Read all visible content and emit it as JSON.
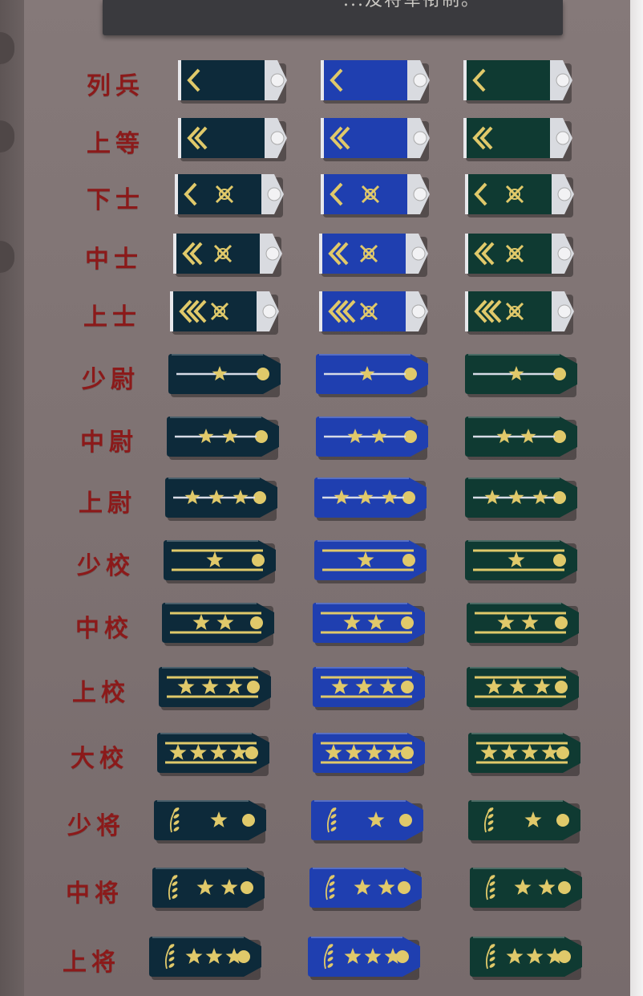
{
  "header": {
    "text": "...及将军衔制。"
  },
  "ranks": [
    {
      "label": "列兵",
      "type": "enlisted",
      "chevrons": 1,
      "emblem": false
    },
    {
      "label": "上等",
      "type": "enlisted",
      "chevrons": 2,
      "emblem": false
    },
    {
      "label": "下士",
      "type": "enlisted",
      "chevrons": 1,
      "emblem": true
    },
    {
      "label": "中士",
      "type": "enlisted",
      "chevrons": 2,
      "emblem": true
    },
    {
      "label": "上士",
      "type": "enlisted",
      "chevrons": 3,
      "emblem": true
    },
    {
      "label": "少尉",
      "type": "junior",
      "stars": 1
    },
    {
      "label": "中尉",
      "type": "junior",
      "stars": 2
    },
    {
      "label": "上尉",
      "type": "junior",
      "stars": 3
    },
    {
      "label": "少校",
      "type": "field",
      "stars": 1
    },
    {
      "label": "中校",
      "type": "field",
      "stars": 2
    },
    {
      "label": "上校",
      "type": "field",
      "stars": 3
    },
    {
      "label": "大校",
      "type": "field",
      "stars": 4
    },
    {
      "label": "少将",
      "type": "general",
      "stars": 1
    },
    {
      "label": "中将",
      "type": "general",
      "stars": 2
    },
    {
      "label": "上将",
      "type": "general",
      "stars": 3
    }
  ],
  "columns": [
    {
      "name": "army",
      "color": "#0d2a3a"
    },
    {
      "name": "navy",
      "color": "#1f3fb0"
    },
    {
      "name": "air",
      "color": "#0f3a32"
    }
  ],
  "colors": {
    "gold": "#e0c96a",
    "label": "#8b1a1a",
    "silver": "#d9dbe0"
  }
}
